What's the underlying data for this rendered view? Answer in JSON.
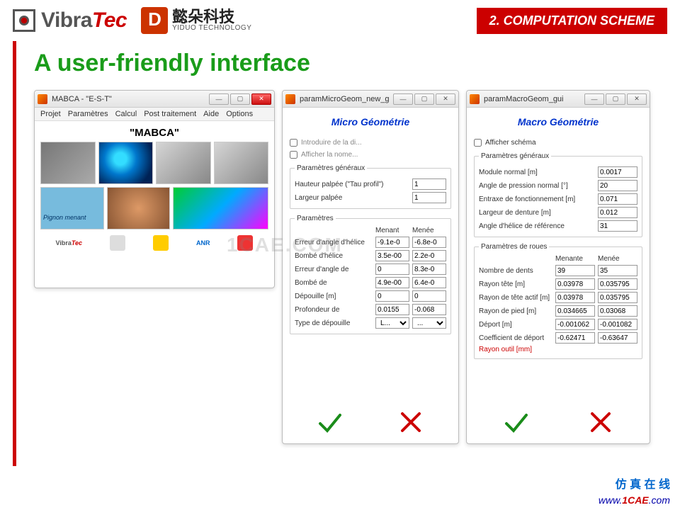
{
  "header": {
    "brand1": {
      "part1": "Vibra",
      "part2": "Tec"
    },
    "brand2": {
      "cn": "懿朵科技",
      "en": "YIDUO TECHNOLOGY"
    },
    "section_badge": "2. COMPUTATION SCHEME"
  },
  "slide_title": "A user-friendly interface",
  "watermark": "1CAE.COM",
  "win1": {
    "title": "MABCA - \"E-S-T\"",
    "menu": [
      "Projet",
      "Paramètres",
      "Calcul",
      "Post traitement",
      "Aide",
      "Options"
    ],
    "app_title": "\"MABCA\"",
    "pignon_label": "Pignon menant",
    "sponsors": {
      "vt1": "Vibra",
      "vt2": "Tec",
      "anr": "ANR"
    }
  },
  "win2": {
    "title": "paramMicroGeom_new_gui",
    "heading": "Micro Géométrie",
    "chk_intro": "Introduire de la di...",
    "chk_nome": "Afficher la nome...",
    "group1": {
      "legend": "Paramètres généraux",
      "rows": [
        {
          "label": "Hauteur palpée (\"Tau profil\")",
          "v": "1"
        },
        {
          "label": "Largeur palpée",
          "v": "1"
        }
      ]
    },
    "group2": {
      "legend": "Paramètres",
      "col_a": "Menant",
      "col_b": "Menée",
      "rows": [
        {
          "label": "Erreur d'angle d'hélice",
          "a": "-9.1e-0",
          "b": "-6.8e-0"
        },
        {
          "label": "Bombé d'hélice",
          "a": "3.5e-00",
          "b": "2.2e-0"
        },
        {
          "label": "Erreur d'angle de",
          "a": "0",
          "b": "8.3e-0"
        },
        {
          "label": "Bombé de",
          "a": "4.9e-00",
          "b": "6.4e-0"
        },
        {
          "label": "Dépouille [m]",
          "a": "0",
          "b": "0"
        },
        {
          "label": "Profondeur de",
          "a": "0.0155",
          "b": "-0.068"
        }
      ],
      "type_row": {
        "label": "Type de dépouille",
        "a": "L...",
        "b": "..."
      }
    }
  },
  "win3": {
    "title": "paramMacroGeom_gui",
    "heading": "Macro Géométrie",
    "chk_schema": "Afficher schéma",
    "group1": {
      "legend": "Paramètres généraux",
      "rows": [
        {
          "label": "Module normal [m]",
          "v": "0.0017"
        },
        {
          "label": "Angle de pression normal [°]",
          "v": "20"
        },
        {
          "label": "Entraxe de fonctionnement [m]",
          "v": "0.071"
        },
        {
          "label": "Largeur de denture [m]",
          "v": "0.012"
        },
        {
          "label": "Angle d'hélice de référence",
          "v": "31"
        }
      ]
    },
    "group2": {
      "legend": "Paramètres de roues",
      "col_a": "Menante",
      "col_b": "Menée",
      "rows": [
        {
          "label": "Nombre de dents",
          "a": "39",
          "b": "35"
        },
        {
          "label": "Rayon tête [m]",
          "a": "0.03978",
          "b": "0.035795"
        },
        {
          "label": "Rayon de tête actif [m]",
          "a": "0.03978",
          "b": "0.035795"
        },
        {
          "label": "Rayon de pied [m]",
          "a": "0.034665",
          "b": "0.03068"
        },
        {
          "label": "Déport [m]",
          "a": "-0.001062",
          "b": "-0.001082"
        },
        {
          "label": "Coefficient de déport",
          "a": "-0.62471",
          "b": "-0.63647"
        }
      ],
      "red_label": "Rayon outil [mm]"
    }
  },
  "footer": {
    "cn": "仿 真 在 线",
    "url_w": "www.",
    "url_d": "1CAE",
    "url_c": ".com"
  }
}
